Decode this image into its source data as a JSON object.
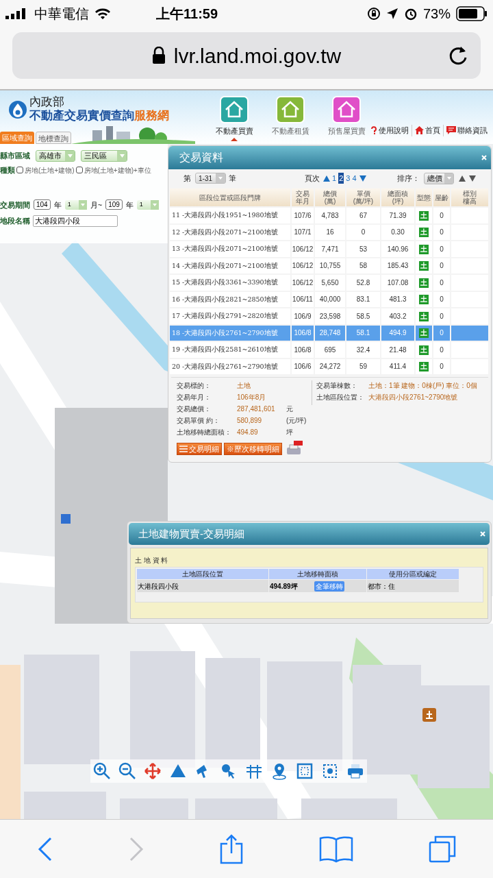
{
  "status_bar": {
    "carrier": "中華電信",
    "time": "上午11:59",
    "battery": "73%"
  },
  "address_bar": {
    "url": "lvr.land.moi.gov.tw"
  },
  "site_header": {
    "org": "內政部",
    "title": "不動產交易實價查詢",
    "title_suffix": "服務網",
    "query_tabs": [
      {
        "label": "區域查詢",
        "selected": true
      },
      {
        "label": "地標查詢",
        "selected": false
      }
    ],
    "nav": [
      {
        "label": "不動產買賣",
        "selected": true,
        "kind": "sale"
      },
      {
        "label": "不動產租賃",
        "selected": false,
        "kind": "rent"
      },
      {
        "label": "預售屋買賣",
        "selected": false,
        "kind": "presale"
      }
    ],
    "links": [
      {
        "label": "使用說明",
        "kind": "help"
      },
      {
        "label": "首頁",
        "kind": "home"
      },
      {
        "label": "聯絡資訊",
        "kind": "contact"
      }
    ]
  },
  "search_form": {
    "region_label": "縣市區域",
    "city": "高雄市",
    "district": "三民區",
    "type_label": "種類",
    "types": [
      {
        "label": "房地(土地+建物)",
        "checked": false
      },
      {
        "label": "房地(土地+建物)+車位",
        "checked": false
      }
    ],
    "period_label": "交易期間",
    "from_year": "104",
    "from_year_unit": "年",
    "from_month": "1",
    "month_sep": "月~",
    "to_year": "109",
    "to_year_unit": "年",
    "to_month": "1",
    "section_label": "地段名稱",
    "section": "大港段四小段"
  },
  "transactions": {
    "title": "交易資料",
    "range_prefix": "第",
    "range": "1-31",
    "range_suffix": "筆",
    "page_label": "頁次",
    "pages": [
      {
        "label": "1",
        "selected": false
      },
      {
        "label": "2",
        "selected": true
      },
      {
        "label": "3",
        "selected": false
      },
      {
        "label": "4",
        "selected": false
      }
    ],
    "sort_label": "排序：",
    "sort": "總價",
    "columns": [
      [
        "區段位置或區段門牌"
      ],
      [
        "交易",
        "年月"
      ],
      [
        "總價",
        "(萬)"
      ],
      [
        "單價",
        "(萬/坪)"
      ],
      [
        "總面積",
        "(坪)"
      ],
      [
        "型態"
      ],
      [
        "屋齡"
      ],
      [
        "標別",
        "樓高"
      ]
    ],
    "rows": [
      {
        "location": "11 -大港段四小段1951~1980地號",
        "date": "107/6",
        "total": "4,783",
        "unit": "67",
        "area": "71.39",
        "type": "土",
        "age": "0",
        "selected": false
      },
      {
        "location": "12 -大港段四小段2071~2100地號",
        "date": "107/1",
        "total": "16",
        "unit": "0",
        "area": "0.30",
        "type": "土",
        "age": "0",
        "selected": false
      },
      {
        "location": "13 -大港段四小段2071~2100地號",
        "date": "106/12",
        "total": "7,471",
        "unit": "53",
        "area": "140.96",
        "type": "土",
        "age": "0",
        "selected": false
      },
      {
        "location": "14 -大港段四小段2071~2100地號",
        "date": "106/12",
        "total": "10,755",
        "unit": "58",
        "area": "185.43",
        "type": "土",
        "age": "0",
        "selected": false
      },
      {
        "location": "15 -大港段四小段3361~3390地號",
        "date": "106/12",
        "total": "5,650",
        "unit": "52.8",
        "area": "107.08",
        "type": "土",
        "age": "0",
        "selected": false
      },
      {
        "location": "16 -大港段四小段2821~2850地號",
        "date": "106/11",
        "total": "40,000",
        "unit": "83.1",
        "area": "481.3",
        "type": "土",
        "age": "0",
        "selected": false
      },
      {
        "location": "17 -大港段四小段2791~2820地號",
        "date": "106/9",
        "total": "23,598",
        "unit": "58.5",
        "area": "403.2",
        "type": "土",
        "age": "0",
        "selected": false
      },
      {
        "location": "18 -大港段四小段2761~2790地號",
        "date": "106/8",
        "total": "28,748",
        "unit": "58.1",
        "area": "494.9",
        "type": "土",
        "age": "0",
        "selected": true
      },
      {
        "location": "19 -大港段四小段2581~2610地號",
        "date": "106/8",
        "total": "695",
        "unit": "32.4",
        "area": "21.48",
        "type": "土",
        "age": "0",
        "selected": false
      },
      {
        "location": "20 -大港段四小段2761~2790地號",
        "date": "106/6",
        "total": "24,272",
        "unit": "59",
        "area": "411.4",
        "type": "土",
        "age": "0",
        "selected": false
      }
    ],
    "summary_left": [
      {
        "label": "交易標的：",
        "value": "土地"
      },
      {
        "label": "交易年月：",
        "value": "106年8月"
      },
      {
        "label": "交易總價：",
        "value": "287,481,601",
        "unit": "元"
      },
      {
        "label": "交易單價 約：",
        "value": "580,899",
        "unit": "(元/坪)"
      },
      {
        "label": "土地移轉總面積：",
        "value": "494.89",
        "unit": "坪"
      }
    ],
    "summary_right": [
      {
        "label": "交易筆棟數：",
        "value": "土地：1筆 建物：0棟(戶) 車位：0個"
      },
      {
        "label": "土地區段位置：",
        "value": "大港段四小段2761~2790地號"
      }
    ],
    "buttons": [
      {
        "label": "交易明細",
        "kind": "list"
      },
      {
        "label": "※歷次移轉明細",
        "kind": "plain"
      }
    ]
  },
  "detail": {
    "title": "土地建物買賣-交易明細",
    "section_title": "土 地 資 料",
    "columns": [
      "土地區段位置",
      "土地移轉面積",
      "使用分區或編定"
    ],
    "rows": [
      {
        "location": "大港段四小段",
        "area": "494.89坪",
        "transfer": "全筆移轉",
        "zoning": "都市：住"
      }
    ]
  }
}
